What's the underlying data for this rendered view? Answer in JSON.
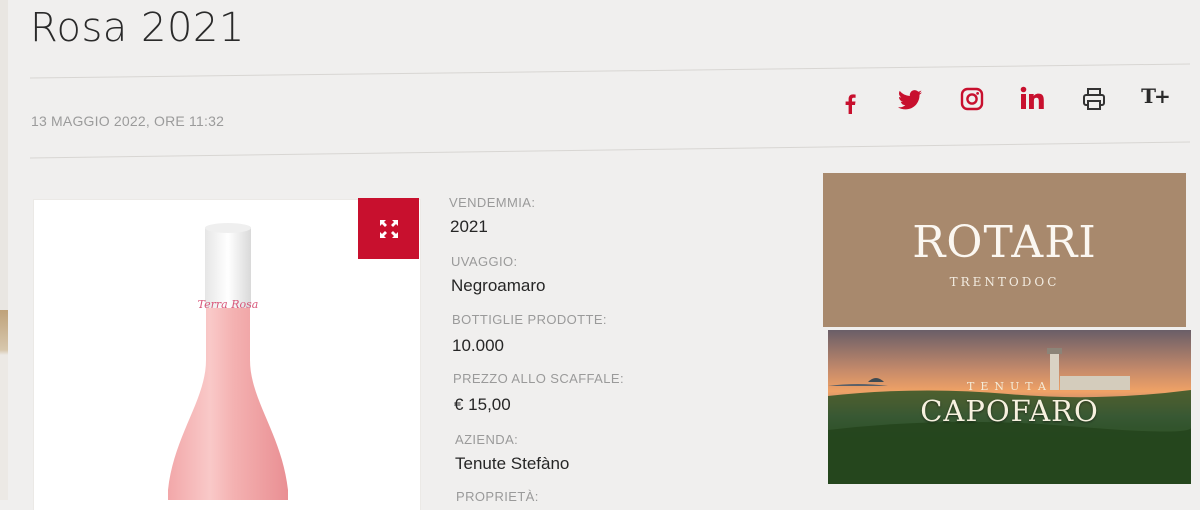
{
  "article": {
    "title": "Rosa 2021",
    "date": "13 MAGGIO 2022, ORE 11:32"
  },
  "share": {
    "icons": [
      "facebook-icon",
      "twitter-icon",
      "instagram-icon",
      "linkedin-icon",
      "print-icon",
      "text-size-icon"
    ],
    "text_size_label": "T+",
    "color": "#c8102e"
  },
  "product": {
    "label_script": "Terra Rosa",
    "expand_icon": "expand-icon",
    "specs": [
      {
        "label": "VENDEMMIA:",
        "value": "2021"
      },
      {
        "label": "UVAGGIO:",
        "value": "Negroamaro"
      },
      {
        "label": "BOTTIGLIE PRODOTTE:",
        "value": "10.000"
      },
      {
        "label": "PREZZO ALLO SCAFFALE:",
        "value": "€ 15,00"
      },
      {
        "label": "AZIENDA:",
        "value": "Tenute Stefàno"
      },
      {
        "label": "PROPRIETÀ:",
        "value": ""
      }
    ]
  },
  "ads": {
    "rotari": {
      "name": "ROTARI",
      "sub": "TRENTODOC"
    },
    "capofaro": {
      "tenuta": "TENUTA",
      "name": "CAPOFARO"
    }
  },
  "colors": {
    "accent": "#c8102e",
    "background": "#f0efee"
  }
}
